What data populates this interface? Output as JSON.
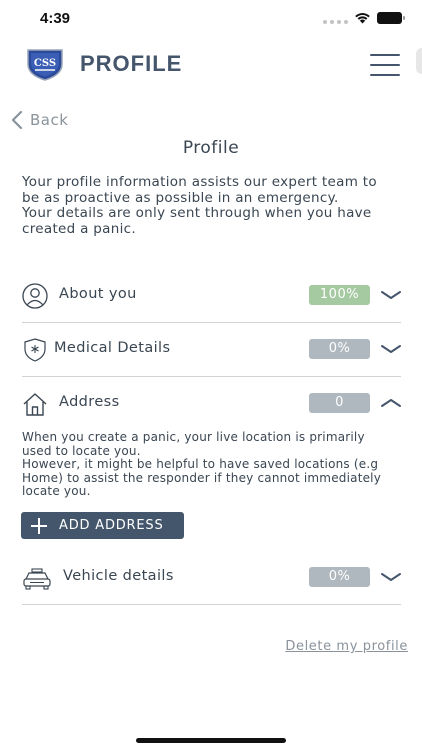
{
  "status_bar": {
    "time": "4:39"
  },
  "header": {
    "title": "PROFILE",
    "logo_text": "CSS"
  },
  "nav": {
    "back_label": "Back"
  },
  "page": {
    "title": "Profile",
    "intro": "Your profile information assists our expert team to be as proactive as possible in an emergency.\nYour details are only sent through when you have created a panic."
  },
  "sections": [
    {
      "label": "About you",
      "badge": "100%",
      "icon": "person-icon",
      "expanded": false
    },
    {
      "label": "Medical Details",
      "badge": "0%",
      "icon": "medical-shield-icon",
      "expanded": false
    },
    {
      "label": "Address",
      "badge": "0",
      "icon": "home-icon",
      "expanded": true
    },
    {
      "label": "Vehicle details",
      "badge": "0%",
      "icon": "car-icon",
      "expanded": false
    }
  ],
  "address": {
    "description": "When you create a panic, your live location is primarily used to locate you.\nHowever, it might be helpful to have saved locations (e.g Home) to assist the responder if they cannot immediately locate you.",
    "add_button_label": "ADD ADDRESS"
  },
  "footer": {
    "delete_label": "Delete my profile"
  },
  "colors": {
    "brand": "#44566b",
    "badge_complete": "#a5c9a1",
    "badge_incomplete": "#afb8bf",
    "muted_text": "#8a939b"
  }
}
